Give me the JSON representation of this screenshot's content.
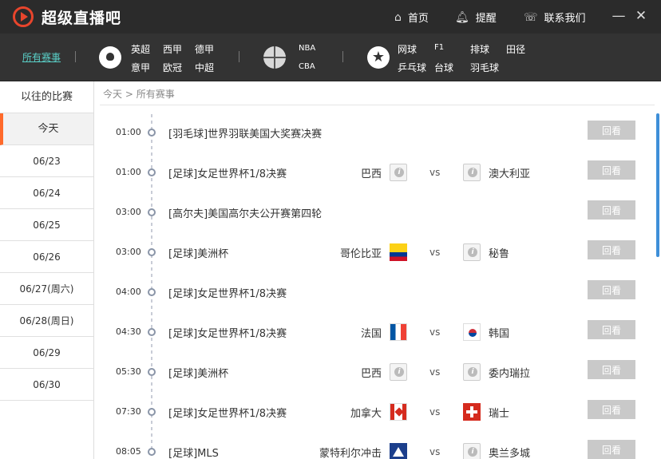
{
  "app": {
    "title": "超级直播吧"
  },
  "topbar": {
    "home": "首页",
    "remind": "提醒",
    "contact": "联系我们"
  },
  "categories": {
    "all": "所有赛事",
    "soccer": [
      "英超",
      "西甲",
      "德甲",
      "意甲",
      "欧冠",
      "中超"
    ],
    "basketball": [
      "NBA",
      "CBA"
    ],
    "other": [
      "网球",
      "F1",
      "排球",
      "田径",
      "乒乓球",
      "台球",
      "羽毛球"
    ]
  },
  "sidebar": {
    "items": [
      "以往的比赛",
      "今天",
      "06/23",
      "06/24",
      "06/25",
      "06/26",
      "06/27(周六)",
      "06/28(周日)",
      "06/29",
      "06/30"
    ],
    "active_index": 1
  },
  "breadcrumb": {
    "today": "今天",
    "sep": ">",
    "current": "所有赛事"
  },
  "replay_label": "回看",
  "vs_label": "vs",
  "matches": [
    {
      "time": "01:00",
      "title": "[羽毛球]世界羽联美国大奖赛决赛",
      "home": "",
      "away": "",
      "home_flag": "",
      "away_flag": ""
    },
    {
      "time": "01:00",
      "title": "[足球]女足世界杯1/8决赛",
      "home": "巴西",
      "away": "澳大利亚",
      "home_flag": "unknown",
      "away_flag": "unknown"
    },
    {
      "time": "03:00",
      "title": "[高尔夫]美国高尔夫公开赛第四轮",
      "home": "",
      "away": "",
      "home_flag": "",
      "away_flag": ""
    },
    {
      "time": "03:00",
      "title": "[足球]美洲杯",
      "home": "哥伦比亚",
      "away": "秘鲁",
      "home_flag": "colombia",
      "away_flag": "unknown"
    },
    {
      "time": "04:00",
      "title": "[足球]女足世界杯1/8决赛",
      "home": "",
      "away": "",
      "home_flag": "",
      "away_flag": ""
    },
    {
      "time": "04:30",
      "title": "[足球]女足世界杯1/8决赛",
      "home": "法国",
      "away": "韩国",
      "home_flag": "france",
      "away_flag": "korea"
    },
    {
      "time": "05:30",
      "title": "[足球]美洲杯",
      "home": "巴西",
      "away": "委内瑞拉",
      "home_flag": "unknown",
      "away_flag": "unknown"
    },
    {
      "time": "07:30",
      "title": "[足球]女足世界杯1/8决赛",
      "home": "加拿大",
      "away": "瑞士",
      "home_flag": "canada",
      "away_flag": "swiss"
    },
    {
      "time": "08:05",
      "title": "[足球]MLS",
      "home": "蒙特利尔冲击",
      "away": "奥兰多城",
      "home_flag": "montreal",
      "away_flag": "unknown"
    }
  ]
}
